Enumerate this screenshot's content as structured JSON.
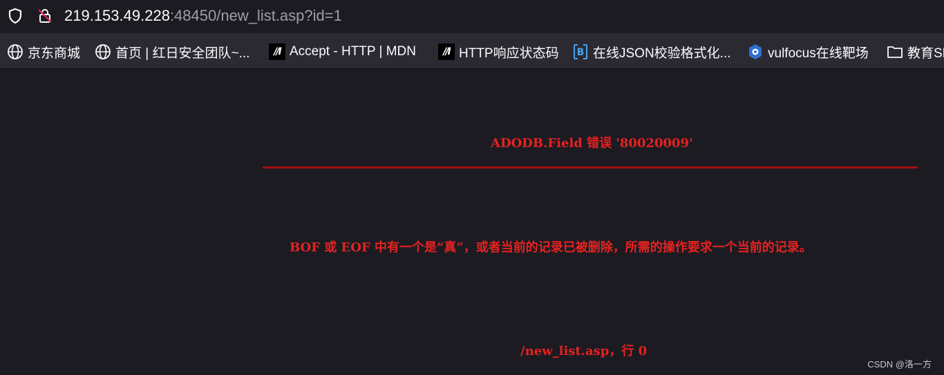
{
  "address_bar": {
    "host": "219.153.49.228",
    "rest": ":48450/new_list.asp?id=1"
  },
  "bookmarks": [
    {
      "label": "京东商城",
      "icon": "globe-icon"
    },
    {
      "label": "首页 | 红日安全团队~...",
      "icon": "globe-icon"
    },
    {
      "label": "Accept - HTTP | MDN",
      "icon": "mdn-icon"
    },
    {
      "label": "HTTP响应状态码",
      "icon": "mdn-icon"
    },
    {
      "label": "在线JSON校验格式化...",
      "icon": "bejson-icon"
    },
    {
      "label": "vulfocus在线靶场",
      "icon": "vulfocus-icon"
    },
    {
      "label": "教育SR",
      "icon": "folder-icon"
    }
  ],
  "error": {
    "title": "ADODB.Field 错误 '80020009'",
    "message": "BOF 或 EOF 中有一个是“真”，或者当前的记录已被删除，所需的操作要求一个当前的记录。",
    "location": "/new_list.asp，行 0"
  },
  "watermark": "CSDN @洛一方",
  "colors": {
    "error_text": "#e52220",
    "rule": "#a50f0f",
    "background": "#1c1b22",
    "toolbar": "#2b2a33"
  }
}
